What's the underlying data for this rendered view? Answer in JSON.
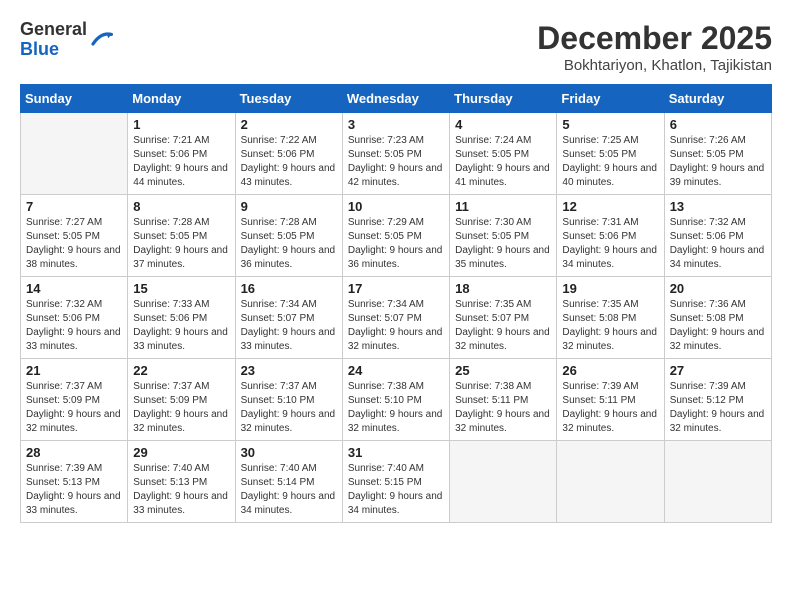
{
  "logo": {
    "general": "General",
    "blue": "Blue"
  },
  "title": "December 2025",
  "location": "Bokhtariyon, Khatlon, Tajikistan",
  "days_of_week": [
    "Sunday",
    "Monday",
    "Tuesday",
    "Wednesday",
    "Thursday",
    "Friday",
    "Saturday"
  ],
  "weeks": [
    [
      {
        "day": "",
        "empty": true
      },
      {
        "day": "1",
        "sunrise": "7:21 AM",
        "sunset": "5:06 PM",
        "daylight": "9 hours and 44 minutes."
      },
      {
        "day": "2",
        "sunrise": "7:22 AM",
        "sunset": "5:06 PM",
        "daylight": "9 hours and 43 minutes."
      },
      {
        "day": "3",
        "sunrise": "7:23 AM",
        "sunset": "5:05 PM",
        "daylight": "9 hours and 42 minutes."
      },
      {
        "day": "4",
        "sunrise": "7:24 AM",
        "sunset": "5:05 PM",
        "daylight": "9 hours and 41 minutes."
      },
      {
        "day": "5",
        "sunrise": "7:25 AM",
        "sunset": "5:05 PM",
        "daylight": "9 hours and 40 minutes."
      },
      {
        "day": "6",
        "sunrise": "7:26 AM",
        "sunset": "5:05 PM",
        "daylight": "9 hours and 39 minutes."
      }
    ],
    [
      {
        "day": "7",
        "sunrise": "7:27 AM",
        "sunset": "5:05 PM",
        "daylight": "9 hours and 38 minutes."
      },
      {
        "day": "8",
        "sunrise": "7:28 AM",
        "sunset": "5:05 PM",
        "daylight": "9 hours and 37 minutes."
      },
      {
        "day": "9",
        "sunrise": "7:28 AM",
        "sunset": "5:05 PM",
        "daylight": "9 hours and 36 minutes."
      },
      {
        "day": "10",
        "sunrise": "7:29 AM",
        "sunset": "5:05 PM",
        "daylight": "9 hours and 36 minutes."
      },
      {
        "day": "11",
        "sunrise": "7:30 AM",
        "sunset": "5:05 PM",
        "daylight": "9 hours and 35 minutes."
      },
      {
        "day": "12",
        "sunrise": "7:31 AM",
        "sunset": "5:06 PM",
        "daylight": "9 hours and 34 minutes."
      },
      {
        "day": "13",
        "sunrise": "7:32 AM",
        "sunset": "5:06 PM",
        "daylight": "9 hours and 34 minutes."
      }
    ],
    [
      {
        "day": "14",
        "sunrise": "7:32 AM",
        "sunset": "5:06 PM",
        "daylight": "9 hours and 33 minutes."
      },
      {
        "day": "15",
        "sunrise": "7:33 AM",
        "sunset": "5:06 PM",
        "daylight": "9 hours and 33 minutes."
      },
      {
        "day": "16",
        "sunrise": "7:34 AM",
        "sunset": "5:07 PM",
        "daylight": "9 hours and 33 minutes."
      },
      {
        "day": "17",
        "sunrise": "7:34 AM",
        "sunset": "5:07 PM",
        "daylight": "9 hours and 32 minutes."
      },
      {
        "day": "18",
        "sunrise": "7:35 AM",
        "sunset": "5:07 PM",
        "daylight": "9 hours and 32 minutes."
      },
      {
        "day": "19",
        "sunrise": "7:35 AM",
        "sunset": "5:08 PM",
        "daylight": "9 hours and 32 minutes."
      },
      {
        "day": "20",
        "sunrise": "7:36 AM",
        "sunset": "5:08 PM",
        "daylight": "9 hours and 32 minutes."
      }
    ],
    [
      {
        "day": "21",
        "sunrise": "7:37 AM",
        "sunset": "5:09 PM",
        "daylight": "9 hours and 32 minutes."
      },
      {
        "day": "22",
        "sunrise": "7:37 AM",
        "sunset": "5:09 PM",
        "daylight": "9 hours and 32 minutes."
      },
      {
        "day": "23",
        "sunrise": "7:37 AM",
        "sunset": "5:10 PM",
        "daylight": "9 hours and 32 minutes."
      },
      {
        "day": "24",
        "sunrise": "7:38 AM",
        "sunset": "5:10 PM",
        "daylight": "9 hours and 32 minutes."
      },
      {
        "day": "25",
        "sunrise": "7:38 AM",
        "sunset": "5:11 PM",
        "daylight": "9 hours and 32 minutes."
      },
      {
        "day": "26",
        "sunrise": "7:39 AM",
        "sunset": "5:11 PM",
        "daylight": "9 hours and 32 minutes."
      },
      {
        "day": "27",
        "sunrise": "7:39 AM",
        "sunset": "5:12 PM",
        "daylight": "9 hours and 32 minutes."
      }
    ],
    [
      {
        "day": "28",
        "sunrise": "7:39 AM",
        "sunset": "5:13 PM",
        "daylight": "9 hours and 33 minutes."
      },
      {
        "day": "29",
        "sunrise": "7:40 AM",
        "sunset": "5:13 PM",
        "daylight": "9 hours and 33 minutes."
      },
      {
        "day": "30",
        "sunrise": "7:40 AM",
        "sunset": "5:14 PM",
        "daylight": "9 hours and 34 minutes."
      },
      {
        "day": "31",
        "sunrise": "7:40 AM",
        "sunset": "5:15 PM",
        "daylight": "9 hours and 34 minutes."
      },
      {
        "day": "",
        "empty": true
      },
      {
        "day": "",
        "empty": true
      },
      {
        "day": "",
        "empty": true
      }
    ]
  ]
}
